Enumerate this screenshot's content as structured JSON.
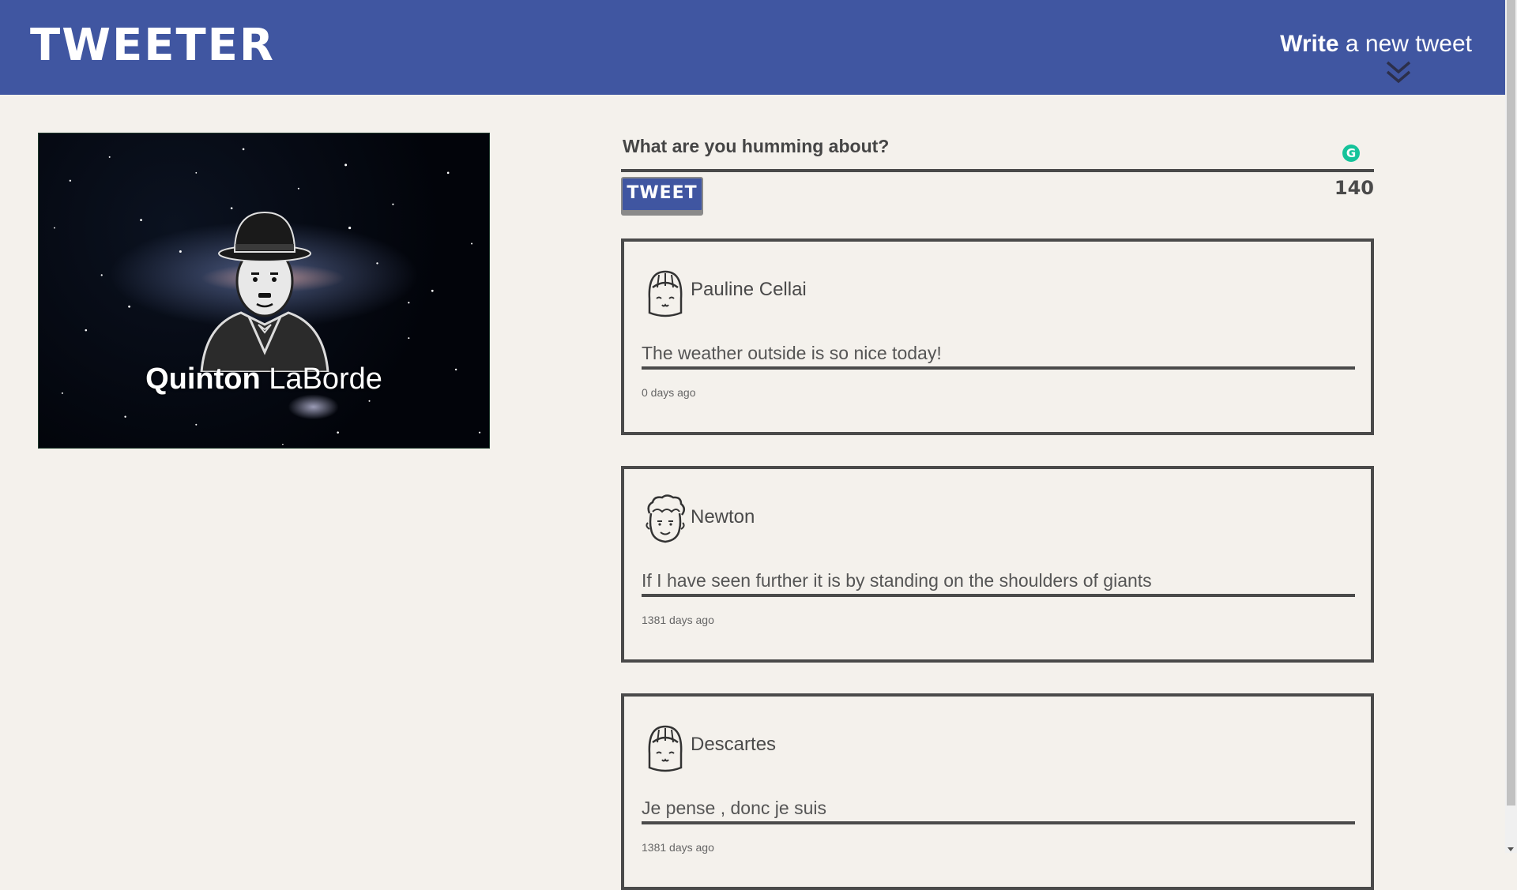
{
  "nav": {
    "logo": "TWEETER",
    "compose_strong": "Write",
    "compose_light": " a new tweet",
    "compose_icon": "double-chevron-down-icon"
  },
  "profile": {
    "first_name": "Quinton",
    "last_name": " LaBorde",
    "avatar_icon": "bowler-hat-man-avatar"
  },
  "new_tweet": {
    "placeholder": "What are you humming about?",
    "button_label": "TWEET",
    "counter": "140",
    "grammarly_label": "G"
  },
  "tweets": [
    {
      "author": "Pauline Cellai",
      "avatar": "girl-avatar-icon",
      "text": "The weather outside is so nice today!",
      "time": "0 days ago"
    },
    {
      "author": "Newton",
      "avatar": "curly-hair-avatar-icon",
      "text": "If I have seen further it is by standing on the shoulders of giants",
      "time": "1381 days ago"
    },
    {
      "author": "Descartes",
      "avatar": "girl-avatar-icon",
      "text": "Je pense , donc je suis",
      "time": "1381 days ago"
    }
  ],
  "colors": {
    "nav_bg": "#4056a1",
    "page_bg": "#f4f1ec",
    "border": "#4a4a4a"
  }
}
